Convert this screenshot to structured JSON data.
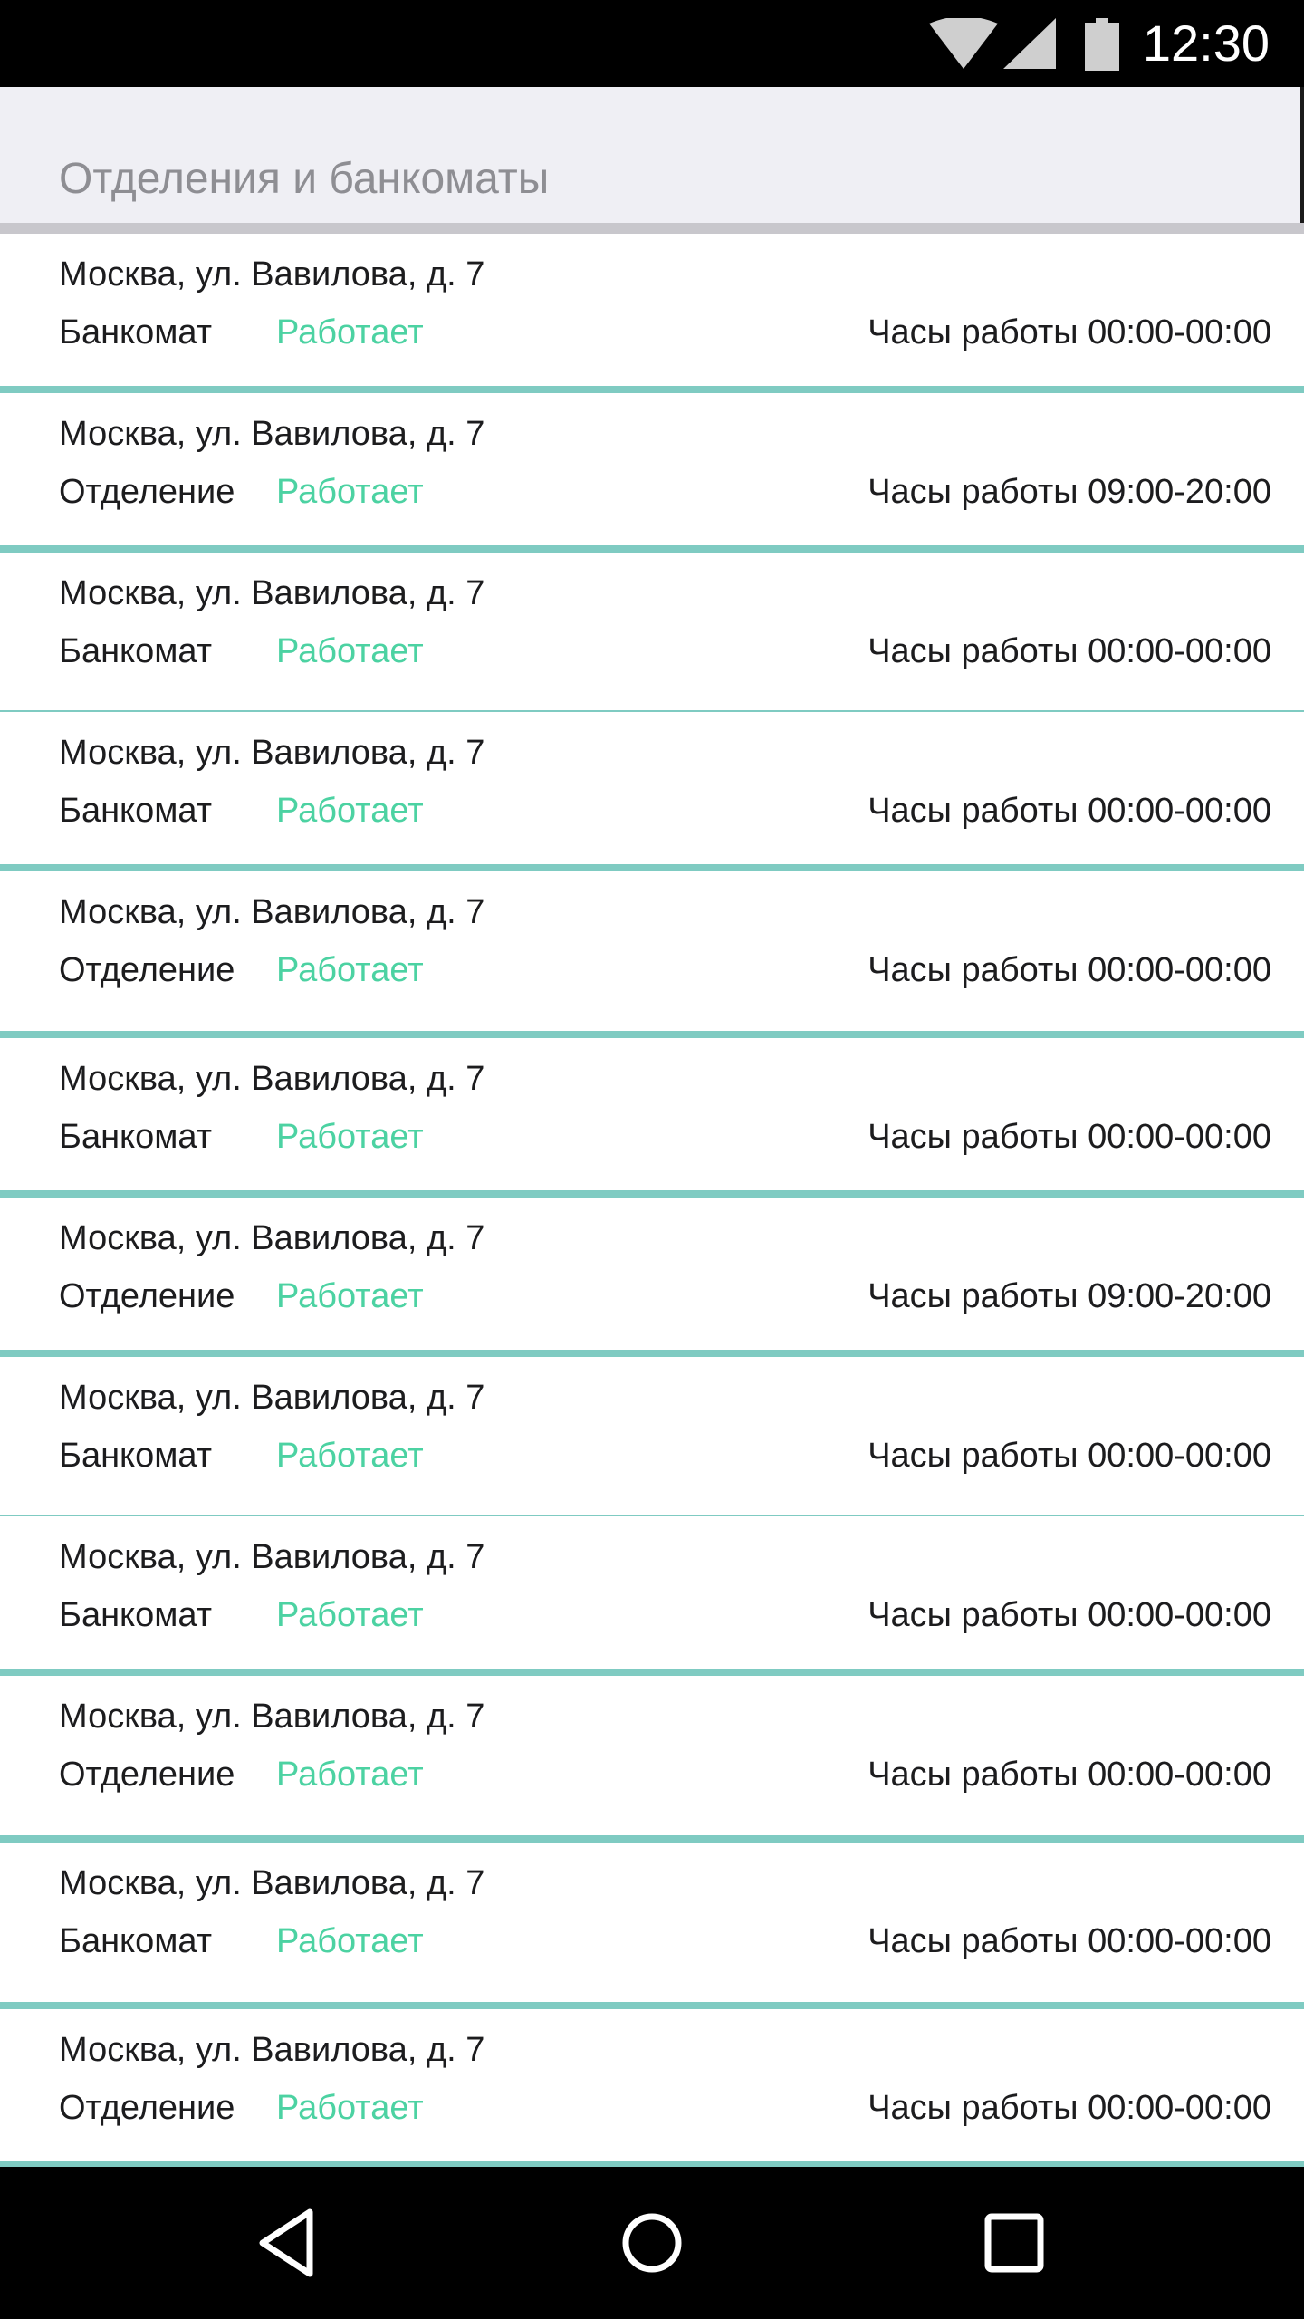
{
  "status_bar": {
    "time": "12:30",
    "icons": [
      "wifi-icon",
      "signal-icon",
      "battery-icon"
    ]
  },
  "header": {
    "title": "Отделения и банкоматы"
  },
  "colors": {
    "status_working": "#4cd2a2",
    "separator_accent": "#7fcbc2",
    "header_bg": "#efeff4",
    "header_text": "#8e8e93"
  },
  "rows": [
    {
      "address": "Москва, ул. Вавилова, д. 7",
      "type": "Банкомат",
      "status": "Работает",
      "hours": "Часы работы 00:00-00:00"
    },
    {
      "address": "Москва, ул. Вавилова, д. 7",
      "type": "Отделение",
      "status": "Работает",
      "hours": "Часы работы 09:00-20:00"
    },
    {
      "address": "Москва, ул. Вавилова, д. 7",
      "type": "Банкомат",
      "status": "Работает",
      "hours": "Часы работы 00:00-00:00"
    },
    {
      "address": "Москва, ул. Вавилова, д. 7",
      "type": "Банкомат",
      "status": "Работает",
      "hours": "Часы работы 00:00-00:00"
    },
    {
      "address": "Москва, ул. Вавилова, д. 7",
      "type": "Отделение",
      "status": "Работает",
      "hours": "Часы работы 00:00-00:00"
    },
    {
      "address": "Москва, ул. Вавилова, д. 7",
      "type": "Банкомат",
      "status": "Работает",
      "hours": "Часы работы 00:00-00:00"
    },
    {
      "address": "Москва, ул. Вавилова, д. 7",
      "type": "Отделение",
      "status": "Работает",
      "hours": "Часы работы 09:00-20:00"
    },
    {
      "address": "Москва, ул. Вавилова, д. 7",
      "type": "Банкомат",
      "status": "Работает",
      "hours": "Часы работы 00:00-00:00"
    },
    {
      "address": "Москва, ул. Вавилова, д. 7",
      "type": "Банкомат",
      "status": "Работает",
      "hours": "Часы работы 00:00-00:00"
    },
    {
      "address": "Москва, ул. Вавилова, д. 7",
      "type": "Отделение",
      "status": "Работает",
      "hours": "Часы работы 00:00-00:00"
    },
    {
      "address": "Москва, ул. Вавилова, д. 7",
      "type": "Банкомат",
      "status": "Работает",
      "hours": "Часы работы 00:00-00:00"
    },
    {
      "address": "Москва, ул. Вавилова, д. 7",
      "type": "Отделение",
      "status": "Работает",
      "hours": "Часы работы 00:00-00:00"
    }
  ],
  "nav_bar": {
    "buttons": [
      "back-icon",
      "home-icon",
      "recents-icon"
    ]
  }
}
